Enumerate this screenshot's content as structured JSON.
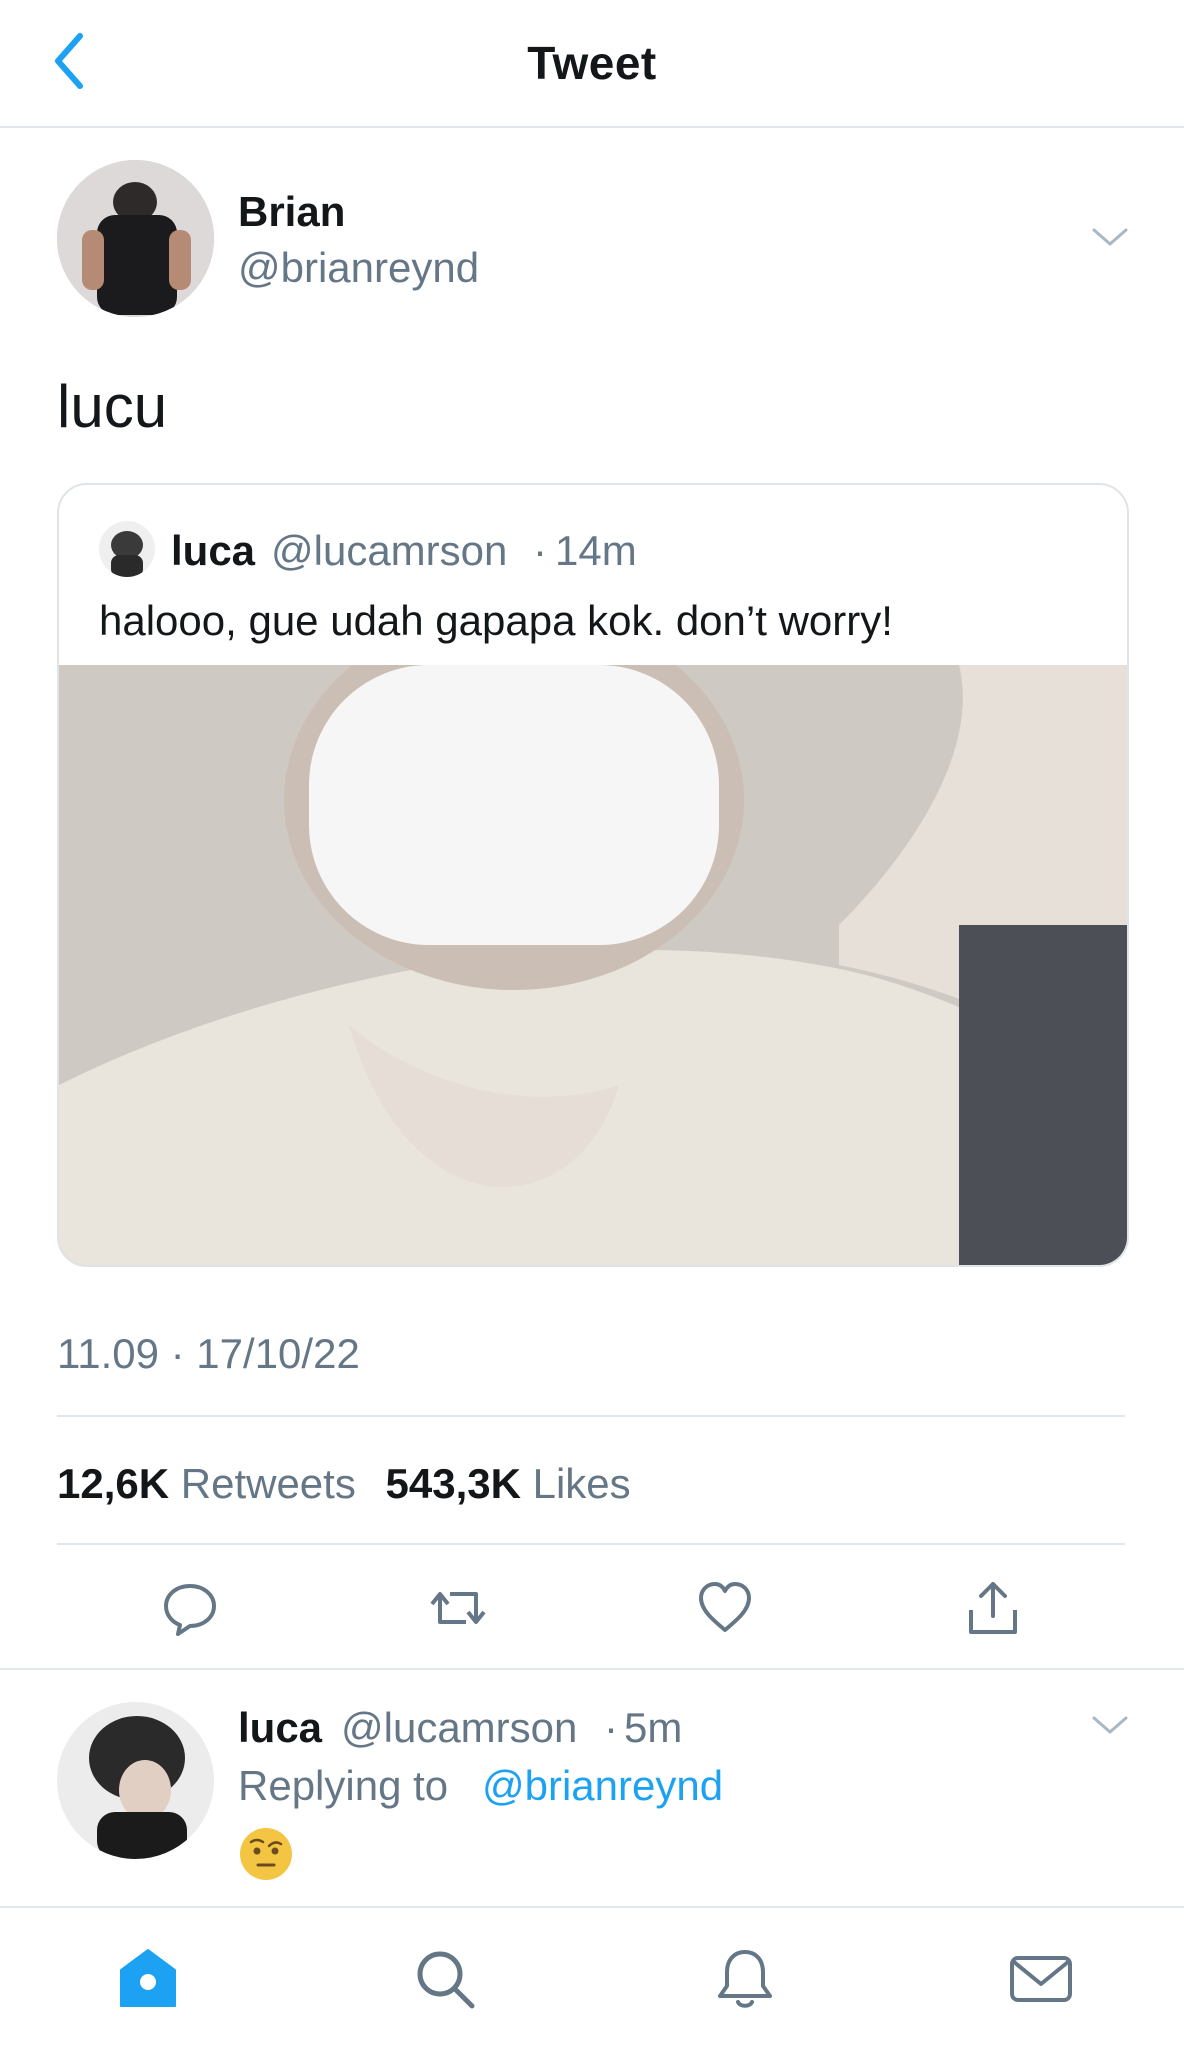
{
  "header": {
    "title": "Tweet"
  },
  "tweet": {
    "author_name": "Brian",
    "author_handle": "@brianreynd",
    "text": "lucu",
    "quote": {
      "name": "luca",
      "handle": "@lucamrson",
      "dot": "·",
      "time": "14m",
      "text": "halooo, gue udah gapapa kok. don’t worry!"
    },
    "timestamp": "11.09 · 17/10/22",
    "retweets_count": "12,6K",
    "retweets_label": "Retweets",
    "likes_count": "543,3K",
    "likes_label": "Likes"
  },
  "reply": {
    "name": "luca",
    "handle": "@lucamrson",
    "dot": "·",
    "time": "5m",
    "replying_prefix": "Replying to",
    "replying_to": "@brianreynd",
    "emoji": "face-with-raised-eyebrow"
  },
  "actions": [
    "reply-icon",
    "retweet-icon",
    "like-icon",
    "share-icon"
  ],
  "nav": [
    "home-icon",
    "search-icon",
    "notifications-icon",
    "messages-icon"
  ],
  "colors": {
    "accent": "#1da1f2",
    "secondary_text": "#657786",
    "divider": "#e1e8ed"
  }
}
